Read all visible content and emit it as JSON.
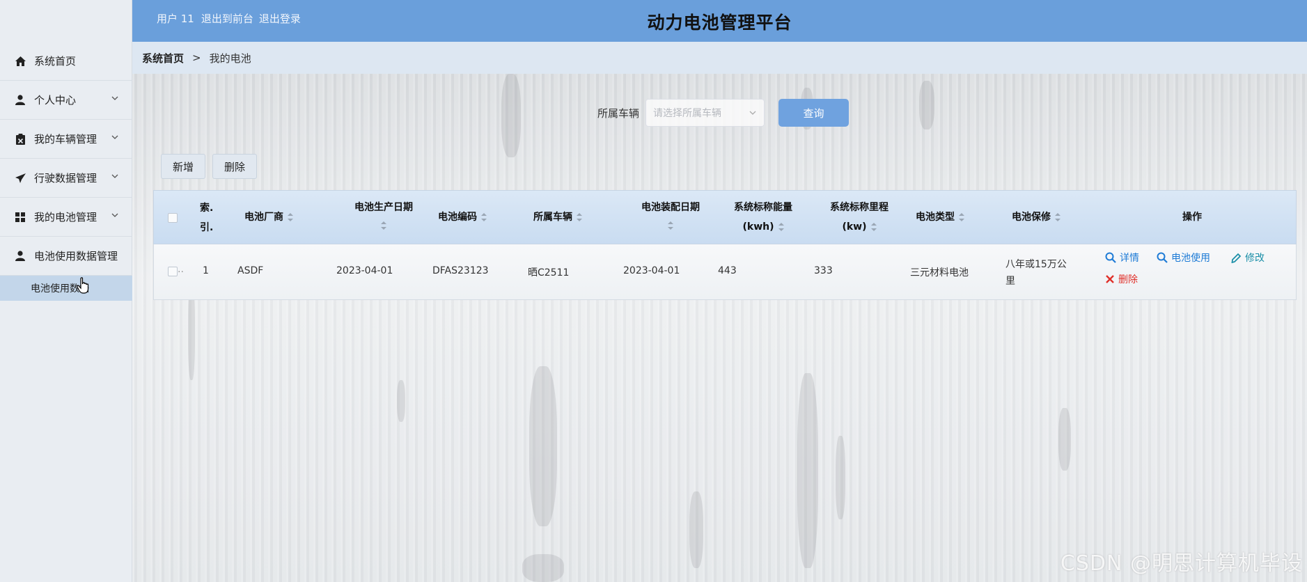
{
  "header": {
    "username": "用户 11",
    "to_front_label": "退出到前台",
    "logout_label": "退出登录",
    "title": "动力电池管理平台",
    "bg_color": "#6a9fdb"
  },
  "sidebar": {
    "items": [
      {
        "label": "系统首页",
        "icon": "home-icon",
        "has_submenu": false
      },
      {
        "label": "个人中心",
        "icon": "user-icon",
        "has_submenu": true
      },
      {
        "label": "我的车辆管理",
        "icon": "clipboard-icon",
        "has_submenu": true
      },
      {
        "label": "行驶数据管理",
        "icon": "paper-plane-icon",
        "has_submenu": true
      },
      {
        "label": "我的电池管理",
        "icon": "grid-icon",
        "has_submenu": true
      },
      {
        "label": "电池使用数据管理",
        "icon": "user-icon",
        "has_submenu": false
      }
    ],
    "active_subitem": "电池使用数据"
  },
  "breadcrumb": {
    "home": "系统首页",
    "separator": ">",
    "current": "我的电池"
  },
  "search": {
    "label": "所属车辆",
    "placeholder": "请选择所属车辆",
    "query_button": "查询"
  },
  "toolbar": {
    "add_label": "新增",
    "delete_label": "删除"
  },
  "table": {
    "headers": {
      "select": "▪.",
      "index_line1": "索.",
      "index_line2": "引.",
      "vendor": "电池厂商",
      "prod_date": "电池生产日期",
      "code": "电池编码",
      "vehicle": "所属车辆",
      "install_date": "电池装配日期",
      "energy_line1": "系统标称能量",
      "energy_line2": "(kwh)",
      "mileage_line1": "系统标称里程",
      "mileage_line2": "(kw)",
      "type": "电池类型",
      "warranty": "电池保修",
      "ops": "操作"
    },
    "rows": [
      {
        "index": "1",
        "vendor": "ASDF",
        "prod_date": "2023-04-01",
        "code": "DFAS23123",
        "vehicle": "晒C2511",
        "install_date": "2023-04-01",
        "energy": "443",
        "mileage": "333",
        "type": "三元材料电池",
        "warranty_line1": "八年或15万公",
        "warranty_line2": "里",
        "select_label": "..",
        "ops": {
          "detail": "详情",
          "usage": "电池使用",
          "edit": "修改",
          "delete": "删除"
        }
      }
    ]
  },
  "watermark": "CSDN @明思计算机毕设"
}
